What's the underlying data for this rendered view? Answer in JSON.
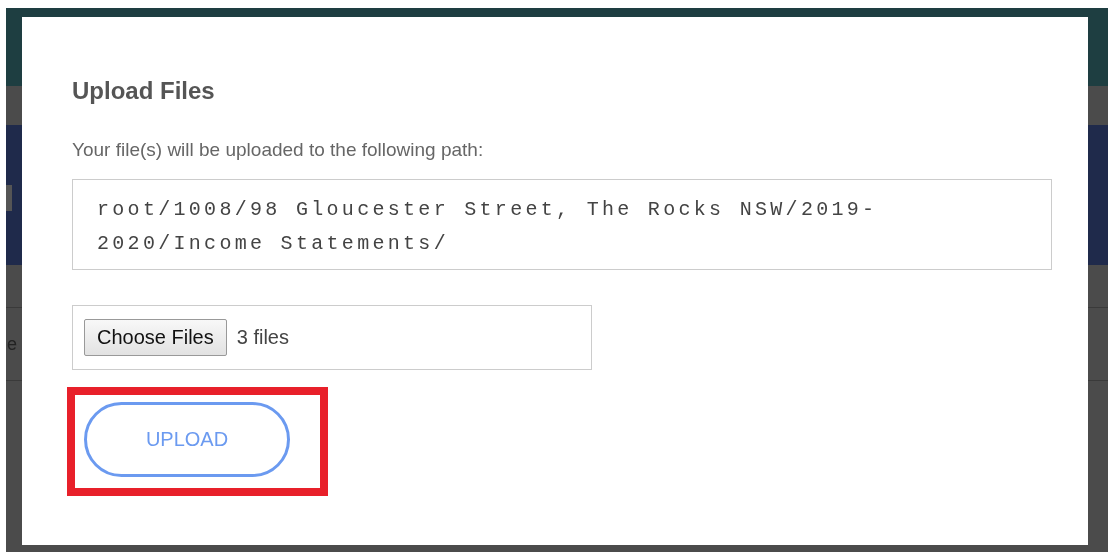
{
  "background": {
    "partial_text": "e"
  },
  "dialog": {
    "title": "Upload Files",
    "description": "Your file(s) will be uploaded to the following path:",
    "path": "root/1008/98 Gloucester Street, The Rocks NSW/2019-2020/Income Statements/",
    "file_picker": {
      "button": "Choose Files",
      "status": "3 files"
    },
    "upload_button": {
      "label": "UPLOAD",
      "highlighted": true
    }
  }
}
